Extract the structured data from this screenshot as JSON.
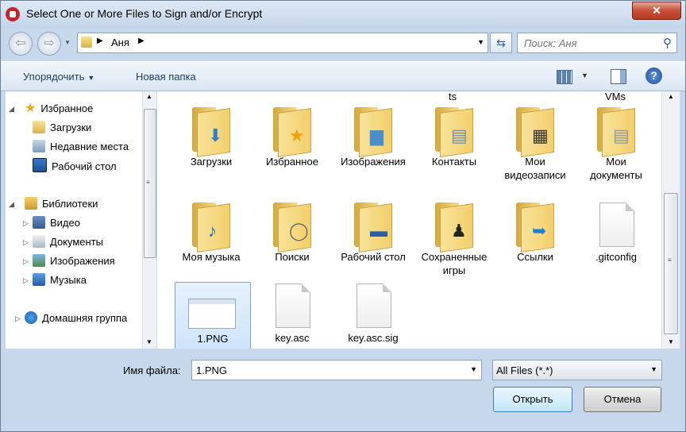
{
  "window": {
    "title": "Select One or More Files to Sign and/or Encrypt",
    "close_glyph": "✕"
  },
  "navigation": {
    "back_glyph": "⇦",
    "forward_glyph": "⇨",
    "breadcrumb": "Аня",
    "search_placeholder": "Поиск: Аня"
  },
  "toolbar": {
    "organize": "Упорядочить",
    "new_folder": "Новая папка",
    "help_glyph": "?"
  },
  "sidebar": {
    "favorites": {
      "label": "Избранное",
      "items": [
        "Загрузки",
        "Недавние места",
        "Рабочий стол"
      ]
    },
    "libraries": {
      "label": "Библиотеки",
      "items": [
        "Видео",
        "Документы",
        "Изображения",
        "Музыка"
      ]
    },
    "homegroup": {
      "label": "Домашняя группа"
    }
  },
  "files": {
    "partial_labels": [
      "ts",
      "VMs"
    ],
    "items": [
      {
        "name": "Загрузки",
        "type": "folder",
        "icon": "download-arrow-icon"
      },
      {
        "name": "Избранное",
        "type": "folder",
        "icon": "star-icon"
      },
      {
        "name": "Изображения",
        "type": "folder",
        "icon": "pictures-icon"
      },
      {
        "name": "Контакты",
        "type": "folder",
        "icon": "contact-card-icon"
      },
      {
        "name": "Мои видеозаписи",
        "type": "folder",
        "icon": "film-icon"
      },
      {
        "name": "Мои документы",
        "type": "folder",
        "icon": "documents-icon"
      },
      {
        "name": "Моя музыка",
        "type": "folder",
        "icon": "music-note-icon"
      },
      {
        "name": "Поиски",
        "type": "folder",
        "icon": "magnifier-icon"
      },
      {
        "name": "Рабочий стол",
        "type": "folder",
        "icon": "monitor-icon"
      },
      {
        "name": "Сохраненные игры",
        "type": "folder",
        "icon": "chess-icon"
      },
      {
        "name": "Ссылки",
        "type": "folder",
        "icon": "link-arrow-icon"
      },
      {
        "name": ".gitconfig",
        "type": "file",
        "icon": "blank-file-icon"
      },
      {
        "name": "1.PNG",
        "type": "image",
        "icon": "png-thumbnail-icon",
        "selected": true
      },
      {
        "name": "key.asc",
        "type": "file",
        "icon": "blank-file-icon"
      },
      {
        "name": "key.asc.sig",
        "type": "file",
        "icon": "blank-file-icon"
      }
    ]
  },
  "footer": {
    "filename_label": "Имя файла:",
    "filename_value": "1.PNG",
    "filetype_value": "All Files (*.*)",
    "open_button": "Открыть",
    "cancel_button": "Отмена"
  },
  "colors": {
    "selection": "#cce4fb",
    "close_button": "#c74e38",
    "accent": "#1e3a66"
  }
}
